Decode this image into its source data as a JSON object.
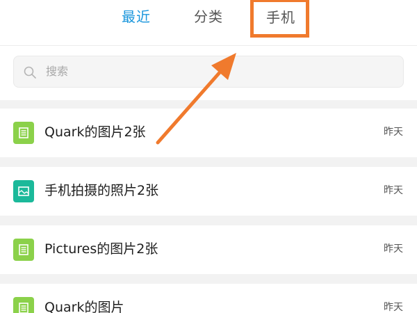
{
  "colors": {
    "accent_blue": "#1a96dc",
    "tab_inactive": "#555555",
    "highlight_orange": "#f07a2d",
    "doc_green": "#8bd14a",
    "image_teal": "#1bb99a"
  },
  "tabs": [
    {
      "label": "最近",
      "active": true
    },
    {
      "label": "分类",
      "active": false
    },
    {
      "label": "手机",
      "active": false
    }
  ],
  "search": {
    "placeholder": "搜索",
    "icon": "search-icon"
  },
  "files": [
    {
      "title": "Quark的图片2张",
      "time": "昨天",
      "icon": "document-icon",
      "color": "#8bd14a"
    },
    {
      "title": "手机拍摄的照片2张",
      "time": "昨天",
      "icon": "image-icon",
      "color": "#1bb99a"
    },
    {
      "title": "Pictures的图片2张",
      "time": "昨天",
      "icon": "document-icon",
      "color": "#8bd14a"
    },
    {
      "title": "Quark的图片",
      "time": "昨天",
      "icon": "document-icon",
      "color": "#8bd14a"
    }
  ]
}
